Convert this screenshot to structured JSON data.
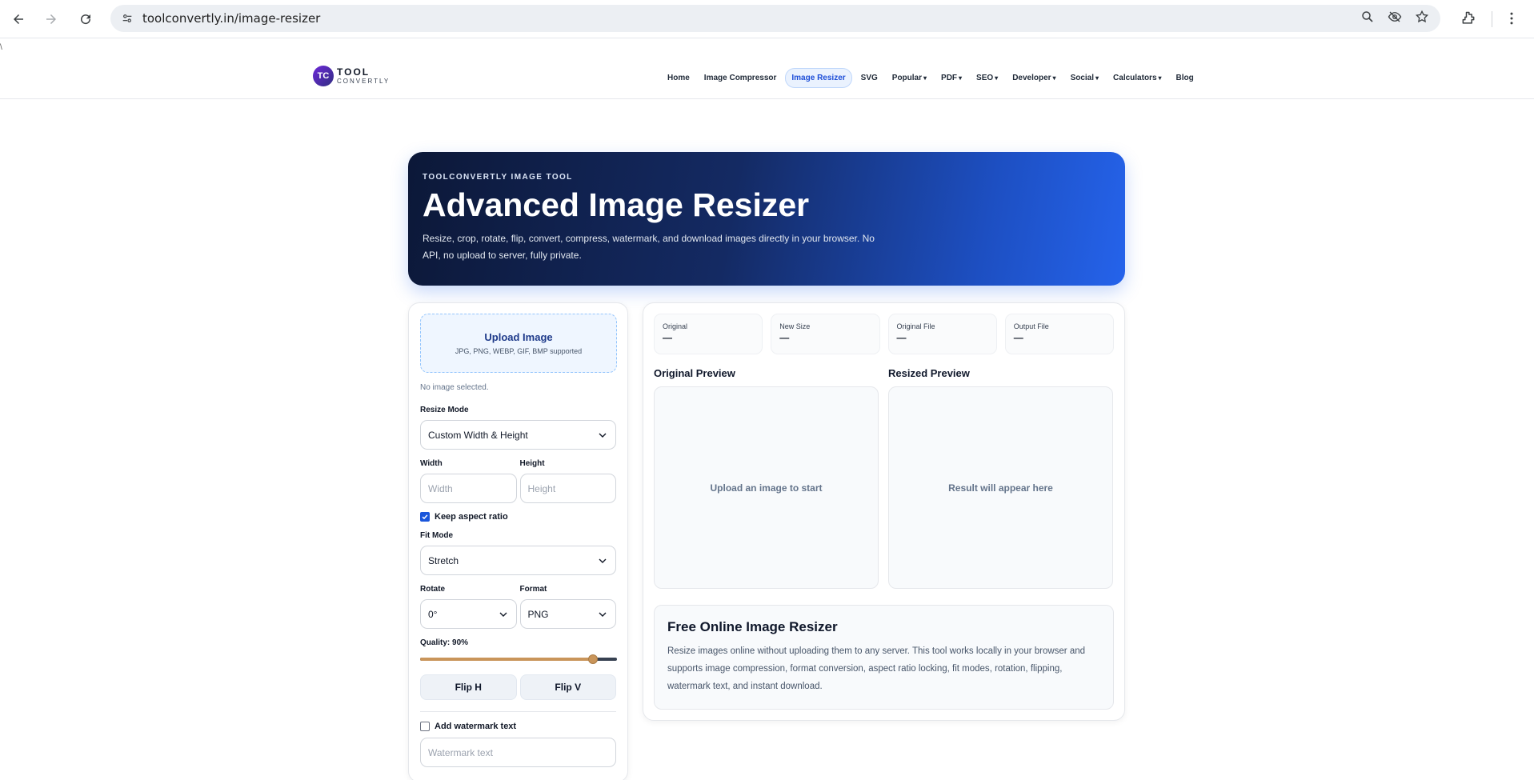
{
  "browser": {
    "url": "toolconvertly.in/image-resizer"
  },
  "stray_char": "\\",
  "logo": {
    "badge": "TC",
    "top": "TOOL",
    "bottom": "CONVERTLY"
  },
  "nav": {
    "items": [
      {
        "label": "Home",
        "dropdown": false,
        "active": false
      },
      {
        "label": "Image Compressor",
        "dropdown": false,
        "active": false
      },
      {
        "label": "Image Resizer",
        "dropdown": false,
        "active": true
      },
      {
        "label": "SVG",
        "dropdown": false,
        "active": false
      },
      {
        "label": "Popular",
        "dropdown": true,
        "active": false
      },
      {
        "label": "PDF",
        "dropdown": true,
        "active": false
      },
      {
        "label": "SEO",
        "dropdown": true,
        "active": false
      },
      {
        "label": "Developer",
        "dropdown": true,
        "active": false
      },
      {
        "label": "Social",
        "dropdown": true,
        "active": false
      },
      {
        "label": "Calculators",
        "dropdown": true,
        "active": false
      },
      {
        "label": "Blog",
        "dropdown": false,
        "active": false
      }
    ],
    "caret": "▾"
  },
  "hero": {
    "eyebrow": "TOOLCONVERTLY IMAGE TOOL",
    "title": "Advanced Image Resizer",
    "description": "Resize, crop, rotate, flip, convert, compress, watermark, and download images directly in your browser. No API, no upload to server, fully private."
  },
  "controls": {
    "upload_title": "Upload Image",
    "upload_sub": "JPG, PNG, WEBP, GIF, BMP supported",
    "file_status": "No image selected.",
    "resize_mode_label": "Resize Mode",
    "resize_mode_value": "Custom Width & Height",
    "width_label": "Width",
    "width_placeholder": "Width",
    "height_label": "Height",
    "height_placeholder": "Height",
    "keep_aspect_label": "Keep aspect ratio",
    "keep_aspect_checked": true,
    "fit_mode_label": "Fit Mode",
    "fit_mode_value": "Stretch",
    "rotate_label": "Rotate",
    "rotate_value": "0°",
    "format_label": "Format",
    "format_value": "PNG",
    "quality_label": "Quality: 90%",
    "quality_fraction": 0.88,
    "flip_h": "Flip H",
    "flip_v": "Flip V",
    "watermark_label": "Add watermark text",
    "watermark_checked": false,
    "watermark_placeholder": "Watermark text"
  },
  "stats": [
    {
      "label": "Original",
      "value": "—"
    },
    {
      "label": "New Size",
      "value": "—"
    },
    {
      "label": "Original File",
      "value": "—"
    },
    {
      "label": "Output File",
      "value": "—"
    }
  ],
  "preview": {
    "original_title": "Original Preview",
    "original_empty": "Upload an image to start",
    "resized_title": "Resized Preview",
    "resized_empty": "Result will appear here"
  },
  "info": {
    "title": "Free Online Image Resizer",
    "text": "Resize images online without uploading them to any server. This tool works locally in your browser and supports image compression, format conversion, aspect ratio locking, fit modes, rotation, flipping, watermark text, and instant download."
  },
  "colors": {
    "accent": "#1a56db",
    "hero_start": "#0c1838",
    "hero_end": "#2563eb",
    "slider_fill": "#c9955a"
  }
}
